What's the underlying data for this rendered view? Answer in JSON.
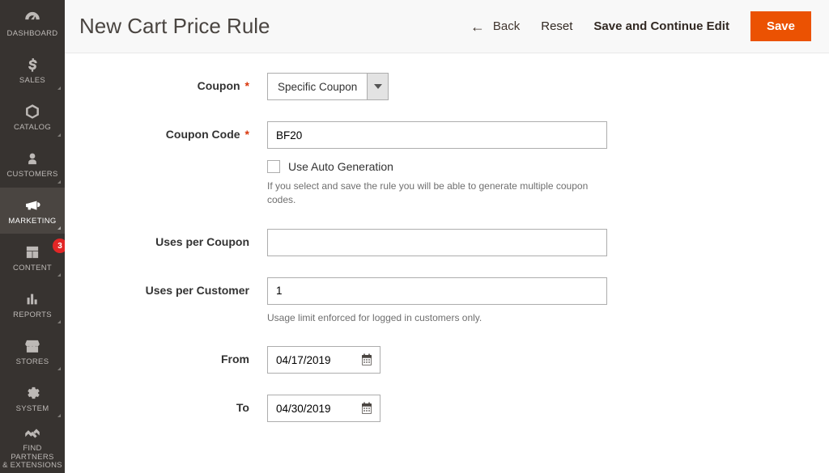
{
  "header": {
    "title": "New Cart Price Rule",
    "back": "Back",
    "reset": "Reset",
    "save_continue": "Save and Continue Edit",
    "save": "Save"
  },
  "sidebar": {
    "items": [
      {
        "label": "DASHBOARD"
      },
      {
        "label": "SALES"
      },
      {
        "label": "CATALOG"
      },
      {
        "label": "CUSTOMERS"
      },
      {
        "label": "MARKETING"
      },
      {
        "label": "CONTENT",
        "badge": "3"
      },
      {
        "label": "REPORTS"
      },
      {
        "label": "STORES"
      },
      {
        "label": "SYSTEM"
      },
      {
        "label": "FIND PARTNERS\n& EXTENSIONS"
      }
    ]
  },
  "form": {
    "coupon_label": "Coupon",
    "coupon_value": "Specific Coupon",
    "coupon_code_label": "Coupon Code",
    "coupon_code_value": "BF20",
    "auto_gen_label": "Use Auto Generation",
    "auto_gen_hint": "If you select and save the rule you will be able to generate multiple coupon codes.",
    "uses_per_coupon_label": "Uses per Coupon",
    "uses_per_coupon_value": "",
    "uses_per_customer_label": "Uses per Customer",
    "uses_per_customer_value": "1",
    "uses_per_customer_hint": "Usage limit enforced for logged in customers only.",
    "from_label": "From",
    "from_value": "04/17/2019",
    "to_label": "To",
    "to_value": "04/30/2019"
  }
}
